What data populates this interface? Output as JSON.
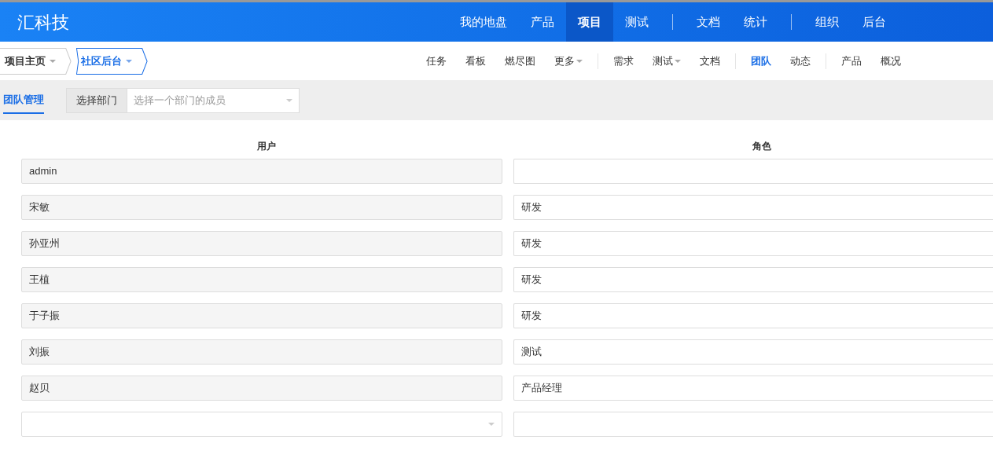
{
  "logo": "汇科技",
  "main_nav": [
    {
      "kind": "link",
      "label": "我的地盘",
      "selected": false
    },
    {
      "kind": "link",
      "label": "产品",
      "selected": false
    },
    {
      "kind": "link",
      "label": "项目",
      "selected": true
    },
    {
      "kind": "link",
      "label": "测试",
      "selected": false
    },
    {
      "kind": "divider"
    },
    {
      "kind": "link",
      "label": "文档",
      "selected": false
    },
    {
      "kind": "link",
      "label": "统计",
      "selected": false
    },
    {
      "kind": "divider"
    },
    {
      "kind": "link",
      "label": "组织",
      "selected": false
    },
    {
      "kind": "link",
      "label": "后台",
      "selected": false
    }
  ],
  "breadcrumbs": [
    {
      "label": "项目主页",
      "selected": false
    },
    {
      "label": "社区后台",
      "selected": true
    }
  ],
  "sub_nav": [
    {
      "kind": "link",
      "label": "任务",
      "selected": false,
      "dropdown": false
    },
    {
      "kind": "link",
      "label": "看板",
      "selected": false,
      "dropdown": false
    },
    {
      "kind": "link",
      "label": "燃尽图",
      "selected": false,
      "dropdown": false
    },
    {
      "kind": "link",
      "label": "更多",
      "selected": false,
      "dropdown": true
    },
    {
      "kind": "divider"
    },
    {
      "kind": "link",
      "label": "需求",
      "selected": false,
      "dropdown": false
    },
    {
      "kind": "link",
      "label": "测试",
      "selected": false,
      "dropdown": true
    },
    {
      "kind": "link",
      "label": "文档",
      "selected": false,
      "dropdown": false
    },
    {
      "kind": "divider"
    },
    {
      "kind": "link",
      "label": "团队",
      "selected": true,
      "dropdown": false
    },
    {
      "kind": "link",
      "label": "动态",
      "selected": false,
      "dropdown": false
    },
    {
      "kind": "divider"
    },
    {
      "kind": "link",
      "label": "产品",
      "selected": false,
      "dropdown": false
    },
    {
      "kind": "link",
      "label": "概况",
      "selected": false,
      "dropdown": false
    }
  ],
  "toolbar": {
    "tab": {
      "label": "团队管理",
      "selected": true
    },
    "dept_label": "选择部门",
    "dept_select": {
      "placeholder": "选择一个部门的成员"
    }
  },
  "table": {
    "columns": [
      "用户",
      "角色"
    ],
    "rows": [
      {
        "kind": "user",
        "user": "admin"
      },
      {
        "kind": "user",
        "user": "宋敏",
        "role": "研发"
      },
      {
        "kind": "user",
        "user": "孙亚州",
        "role": "研发"
      },
      {
        "kind": "user",
        "user": "王植",
        "role": "研发"
      },
      {
        "kind": "user",
        "user": "于子振",
        "role": "研发"
      },
      {
        "kind": "user",
        "user": "刘振",
        "role": "测试"
      },
      {
        "kind": "user",
        "user": "赵贝",
        "role": "产品经理"
      },
      {
        "kind": "select"
      }
    ]
  }
}
